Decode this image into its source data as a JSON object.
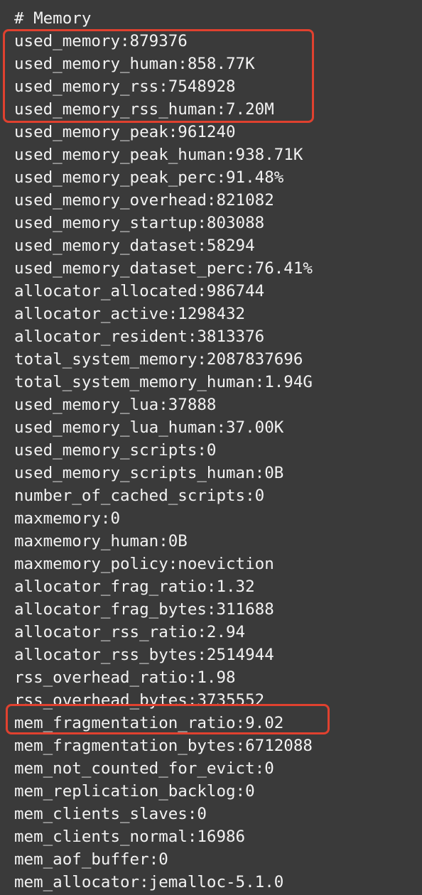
{
  "terminal": {
    "section_header": "# Memory",
    "lines": [
      "used_memory:879376",
      "used_memory_human:858.77K",
      "used_memory_rss:7548928",
      "used_memory_rss_human:7.20M",
      "used_memory_peak:961240",
      "used_memory_peak_human:938.71K",
      "used_memory_peak_perc:91.48%",
      "used_memory_overhead:821082",
      "used_memory_startup:803088",
      "used_memory_dataset:58294",
      "used_memory_dataset_perc:76.41%",
      "allocator_allocated:986744",
      "allocator_active:1298432",
      "allocator_resident:3813376",
      "total_system_memory:2087837696",
      "total_system_memory_human:1.94G",
      "used_memory_lua:37888",
      "used_memory_lua_human:37.00K",
      "used_memory_scripts:0",
      "used_memory_scripts_human:0B",
      "number_of_cached_scripts:0",
      "maxmemory:0",
      "maxmemory_human:0B",
      "maxmemory_policy:noeviction",
      "allocator_frag_ratio:1.32",
      "allocator_frag_bytes:311688",
      "allocator_rss_ratio:2.94",
      "allocator_rss_bytes:2514944",
      "rss_overhead_ratio:1.98",
      "rss_overhead_bytes:3735552",
      "mem_fragmentation_ratio:9.02",
      "mem_fragmentation_bytes:6712088",
      "mem_not_counted_for_evict:0",
      "mem_replication_backlog:0",
      "mem_clients_slaves:0",
      "mem_clients_normal:16986",
      "mem_aof_buffer:0",
      "mem_allocator:jemalloc-5.1.0"
    ]
  },
  "annotations": {
    "highlight_color": "#e0412f"
  }
}
